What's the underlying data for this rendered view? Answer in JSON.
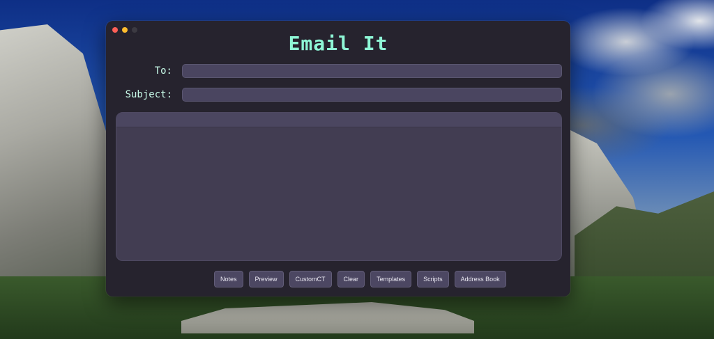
{
  "window": {
    "title": "Email It",
    "colors": {
      "accent": "#8ef7d6",
      "window_bg": "#26232e",
      "field_bg": "#4a4560"
    }
  },
  "form": {
    "to_label": "To:",
    "to_value": "",
    "subject_label": "Subject:",
    "subject_value": "",
    "body_value": ""
  },
  "buttons": [
    "Notes",
    "Preview",
    "CustomCT",
    "Clear",
    "Templates",
    "Scripts",
    "Address Book"
  ],
  "traffic_lights": [
    "close",
    "minimize",
    "zoom-disabled"
  ]
}
